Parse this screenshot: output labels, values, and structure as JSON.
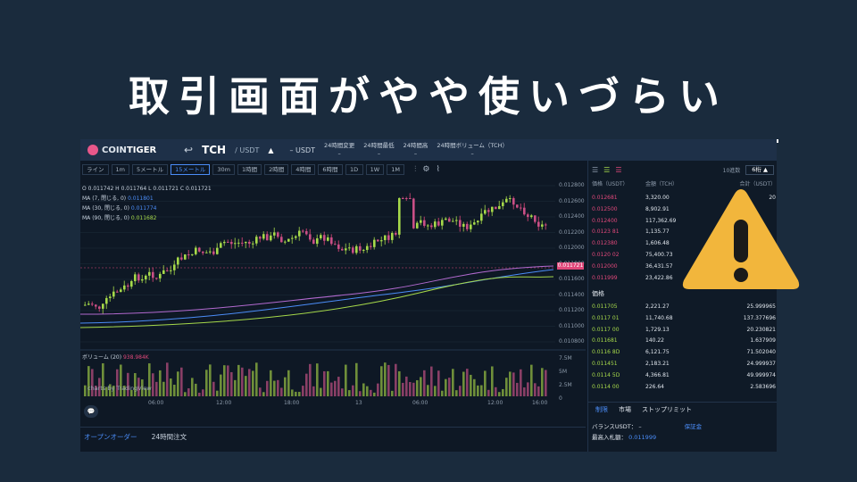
{
  "headline": "取引画面がやや使いづらい",
  "app": {
    "logo": "COINTIGER",
    "logo_prefix": "COIN",
    "logo_suffix": "TIGER",
    "back_glyph": "↩",
    "pair_base": "TCH",
    "pair_quote": "/ USDT",
    "pair_caret": "▲",
    "ticker": "– USDT",
    "stats": [
      {
        "label": "24時間変更"
      },
      {
        "label": "24時間最低"
      },
      {
        "label": "24時間高"
      },
      {
        "label": "24時間ボリューム（TCH）"
      }
    ]
  },
  "timeframes": [
    "ライン",
    "1m",
    "5メートル",
    "15メートル",
    "30m",
    "1時間",
    "2時間",
    "4時間",
    "6時間",
    "1D",
    "1W",
    "1M"
  ],
  "active_timeframe": "15メートル",
  "legend": {
    "ohlc": "O 0.011742  H 0.011764  L 0.011721  C 0.011721",
    "ma7_label": "MA (7, 閉じる, 0)",
    "ma7_value": "0.011801",
    "ma30_label": "MA (30, 閉じる, 0)",
    "ma30_value": "0.011774",
    "ma90_label": "MA (90, 閉じる, 0)",
    "ma90_value": "0.011682"
  },
  "price_axis": [
    "0.012800",
    "0.012600",
    "0.012400",
    "0.012200",
    "0.012000",
    "0.011800",
    "0.011600",
    "0.011400",
    "0.011200",
    "0.011000",
    "0.010800"
  ],
  "current_price": "0.011721",
  "volume": {
    "label": "ボリューム (20)",
    "value": "938.984K"
  },
  "volume_axis": [
    "7.5M",
    "5M",
    "2.5M",
    "0"
  ],
  "tradingview_credit": "charts by TradingView",
  "time_axis": [
    "06:00",
    "12:00",
    "18:00",
    "13",
    "06:00",
    "12:00",
    "16:00"
  ],
  "order_tabs": [
    "オープンオーダー",
    "24時間注文"
  ],
  "orderbook": {
    "depth_label": "10進数",
    "depth_value": "6桁",
    "headers": [
      "価格（USDT）",
      "金額（TCH）",
      "合計（USDT）"
    ],
    "asks": [
      {
        "price": "0.012681",
        "amount": "3,320.00",
        "total": "20"
      },
      {
        "price": "0.012500",
        "amount": "8,902.91",
        "total": ""
      },
      {
        "price": "0.012400",
        "amount": "117,362.69",
        "total": ""
      },
      {
        "price": "0.0123 81",
        "amount": "1,135.77",
        "total": ""
      },
      {
        "price": "0.012380",
        "amount": "1,606.48",
        "total": ""
      },
      {
        "price": "0.0120 02",
        "amount": "75,400.73",
        "total": ""
      },
      {
        "price": "0.012000",
        "amount": "36,431.57",
        "total": ""
      },
      {
        "price": "0.011999",
        "amount": "23,422.86",
        "total": ""
      }
    ],
    "mid_label": "価格",
    "bids": [
      {
        "price": "0.011705",
        "amount": "2,221.27",
        "total": "25.999965"
      },
      {
        "price": "0.0117 01",
        "amount": "11,740.68",
        "total": "137.377696"
      },
      {
        "price": "0.0117 00",
        "amount": "1,729.13",
        "total": "20.230821"
      },
      {
        "price": "0.011681",
        "amount": "140.22",
        "total": "1.637909"
      },
      {
        "price": "0.0116 8D",
        "amount": "6,121.75",
        "total": "71.502040"
      },
      {
        "price": "0.011451",
        "amount": "2,183.21",
        "total": "24.999937"
      },
      {
        "price": "0.0114 5D",
        "amount": "4,366.81",
        "total": "49.999974"
      },
      {
        "price": "0.0114 00",
        "amount": "226.64",
        "total": "2.583696"
      }
    ]
  },
  "trade": {
    "tabs": [
      "制限",
      "市場",
      "ストップリミット"
    ],
    "balance_label": "バランスUSDT：",
    "balance_value": "–",
    "deposit_link": "保証金",
    "best_bid_label": "最高入札額：",
    "best_bid_value": "0.011999"
  },
  "colors": {
    "up": "#a6d94a",
    "down": "#e0487a",
    "accent": "#4b8df8",
    "warning": "#f2b63c"
  },
  "chart_data": {
    "type": "candlestick",
    "series": [
      {
        "name": "MA (7, 閉じる, 0)",
        "value": 0.011801
      },
      {
        "name": "MA (30, 閉じる, 0)",
        "value": 0.011774
      },
      {
        "name": "MA (90, 閉じる, 0)",
        "value": 0.011682
      }
    ],
    "ylim": [
      0.0108,
      0.0128
    ],
    "last": 0.011721,
    "volume_ylim": [
      0,
      7500000
    ]
  }
}
